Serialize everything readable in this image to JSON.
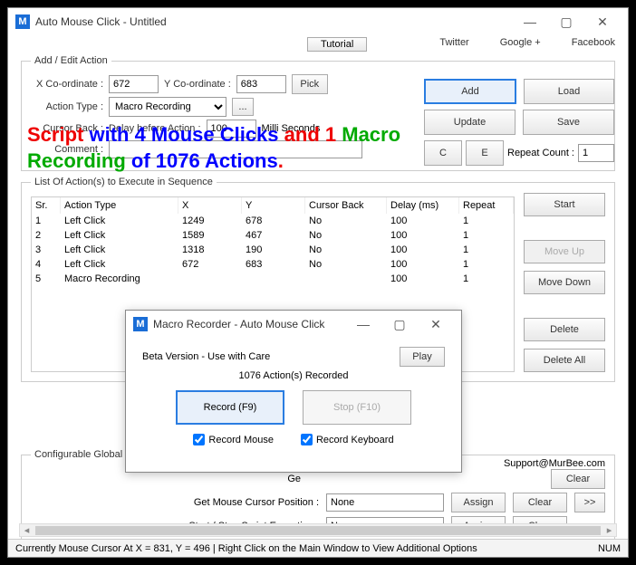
{
  "main": {
    "title": "Auto Mouse Click - Untitled",
    "logo": "M",
    "tutorial": "Tutorial",
    "links": [
      "Twitter",
      "Google +",
      "Facebook"
    ]
  },
  "addEdit": {
    "legend": "Add / Edit Action",
    "xLabel": "X Co-ordinate :",
    "xVal": "672",
    "yLabel": "Y Co-ordinate :",
    "yVal": "683",
    "pick": "Pick",
    "actionTypeLabel": "Action Type :",
    "actionTypeVal": "Macro Recording",
    "more": "...",
    "cursorBackLabel": "Cursor Back :",
    "delayLabel": "Delay before Action :",
    "delayVal": "100",
    "delayUnit": "Milli Seconds",
    "commentLabel": "Comment :",
    "commentVal": ""
  },
  "sideBtns": {
    "add": "Add",
    "load": "Load",
    "update": "Update",
    "save": "Save",
    "c": "C",
    "e": "E",
    "repeatLabel": "Repeat Count :",
    "repeatVal": "1"
  },
  "overlay": {
    "p1a": "Script ",
    "p1b": "with ",
    "p1c": "4 Mouse Clicks ",
    "p1d": "and ",
    "p1e": "1 ",
    "p1f": "Macro",
    "p2a": "Recording ",
    "p2b": "of 1076 Actions",
    "p2c": "."
  },
  "list": {
    "legend": "List Of Action(s) to Execute in Sequence",
    "headers": [
      "Sr.",
      "Action Type",
      "X",
      "Y",
      "Cursor Back",
      "Delay (ms)",
      "Repeat"
    ],
    "rows": [
      [
        "1",
        "Left Click",
        "1249",
        "678",
        "No",
        "100",
        "1"
      ],
      [
        "2",
        "Left Click",
        "1589",
        "467",
        "No",
        "100",
        "1"
      ],
      [
        "3",
        "Left Click",
        "1318",
        "190",
        "No",
        "100",
        "1"
      ],
      [
        "4",
        "Left Click",
        "672",
        "683",
        "No",
        "100",
        "1"
      ],
      [
        "5",
        "Macro Recording",
        "",
        "",
        "",
        "100",
        "1"
      ]
    ],
    "buttons": {
      "start": "Start",
      "moveUp": "Move Up",
      "moveDown": "Move Down",
      "delete": "Delete",
      "deleteAll": "Delete All"
    }
  },
  "recorder": {
    "title": "Macro Recorder - Auto Mouse Click",
    "beta": "Beta Version - Use with Care",
    "play": "Play",
    "recorded": "1076 Action(s) Recorded",
    "record": "Record (F9)",
    "stop": "Stop (F10)",
    "recMouse": "Record Mouse",
    "recKb": "Record Keyboard"
  },
  "config": {
    "legend": "Configurable Global",
    "support": "Support@MurBee.com",
    "rows": [
      {
        "label": "Ge",
        "val": "",
        "assign": "",
        "clear": "Clear"
      },
      {
        "label": "Get Mouse Cursor Position :",
        "val": "None",
        "assign": "Assign",
        "clear": "Clear",
        "more": ">>"
      },
      {
        "label": "Start / Stop Script Execution :",
        "val": "None",
        "assign": "Assign",
        "clear": "Clear"
      }
    ]
  },
  "status": {
    "text": "Currently Mouse Cursor At X = 831, Y = 496 | Right Click on the Main Window to View Additional Options",
    "num": "NUM"
  }
}
